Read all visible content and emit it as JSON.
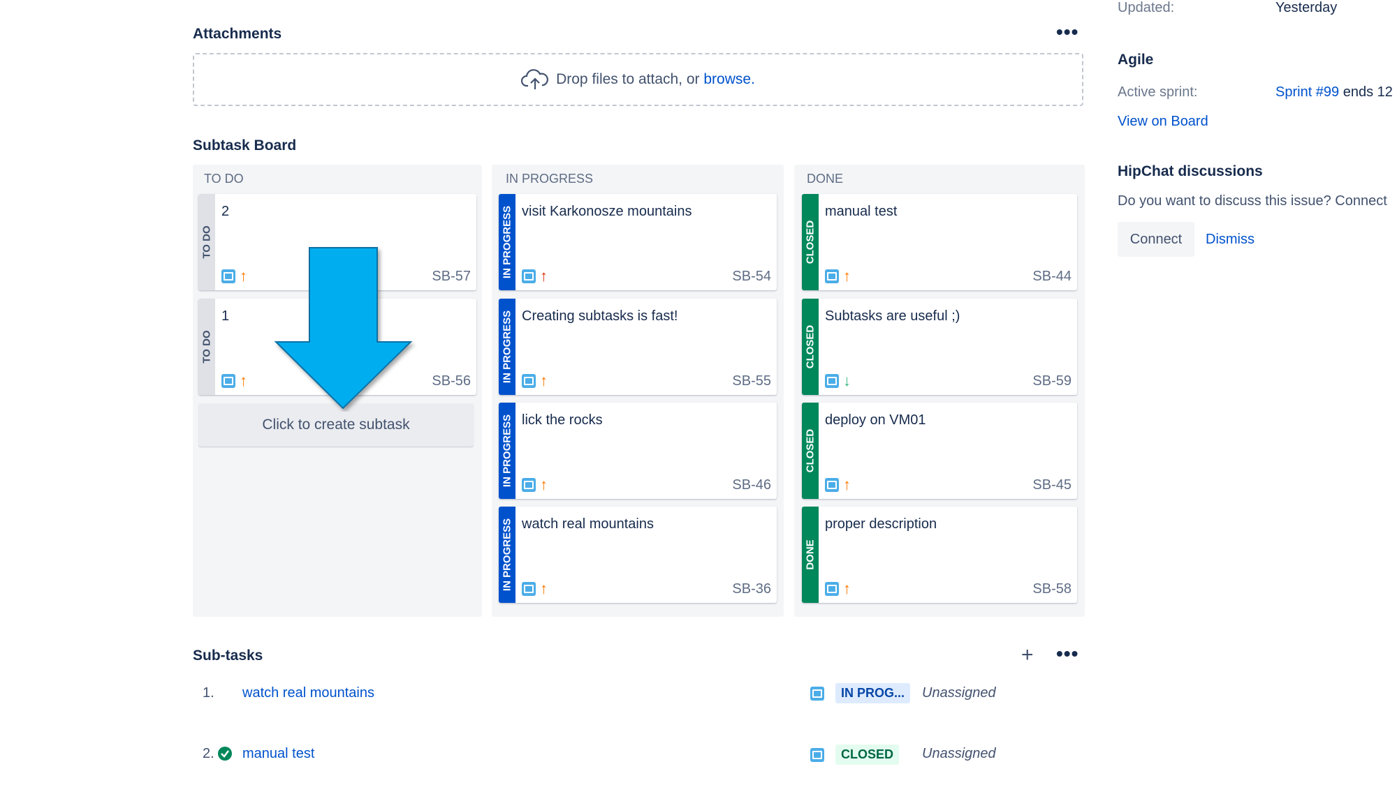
{
  "attachments": {
    "title": "Attachments",
    "more": "•••",
    "drop_text": "Drop files to attach, or ",
    "browse": "browse.",
    "icon": "cloud-upload-icon"
  },
  "board": {
    "title": "Subtask Board",
    "columns": [
      {
        "title": "TO DO",
        "cards": [
          {
            "status": "TO DO",
            "summary": "2",
            "key": "SB-57",
            "priority": "major"
          },
          {
            "status": "TO DO",
            "summary": "1",
            "key": "SB-56",
            "priority": "major"
          }
        ]
      },
      {
        "title": "IN PROGRESS",
        "cards": [
          {
            "status": "IN PROGRESS",
            "summary": "visit Karkonosze mountains",
            "key": "SB-54",
            "priority": "highest"
          },
          {
            "status": "IN PROGRESS",
            "summary": "Creating subtasks is fast!",
            "key": "SB-55",
            "priority": "major"
          },
          {
            "status": "IN PROGRESS",
            "summary": "lick the rocks",
            "key": "SB-46",
            "priority": "major"
          },
          {
            "status": "IN PROGRESS",
            "summary": "watch real mountains",
            "key": "SB-36",
            "priority": "major"
          }
        ]
      },
      {
        "title": "DONE",
        "cards": [
          {
            "status": "CLOSED",
            "summary": "manual test",
            "key": "SB-44",
            "priority": "major"
          },
          {
            "status": "CLOSED",
            "summary": "Subtasks are useful ;)",
            "key": "SB-59",
            "priority": "low"
          },
          {
            "status": "CLOSED",
            "summary": "deploy on VM01",
            "key": "SB-45",
            "priority": "major"
          },
          {
            "status": "DONE",
            "summary": "proper description",
            "key": "SB-58",
            "priority": "major"
          }
        ]
      }
    ],
    "create_label": "Click to create subtask"
  },
  "subtasks": {
    "title": "Sub-tasks",
    "add": "+",
    "more": "•••",
    "rows": [
      {
        "num": "1.",
        "summary": "watch real mountains",
        "status": "IN PROG...",
        "assignee": "Unassigned"
      },
      {
        "num": "2.",
        "summary": "manual test",
        "status": "CLOSED",
        "assignee": "Unassigned"
      }
    ]
  },
  "sidebar": {
    "updated_label": "Updated:",
    "updated_value": "Yesterday",
    "agile_title": "Agile",
    "active_sprint_label": "Active sprint:",
    "sprint_link": "Sprint #99",
    "sprint_rest": " ends 12",
    "view_on_board": "View on Board",
    "hipchat_title": "HipChat discussions",
    "hipchat_text": "Do you want to discuss this issue? Connect",
    "connect": "Connect",
    "dismiss": "Dismiss"
  },
  "colors": {
    "in_progress": "#0052cc",
    "closed": "#00875a",
    "todo_strip": "#dfe1e6",
    "overlay_arrow": "#00aeef"
  }
}
